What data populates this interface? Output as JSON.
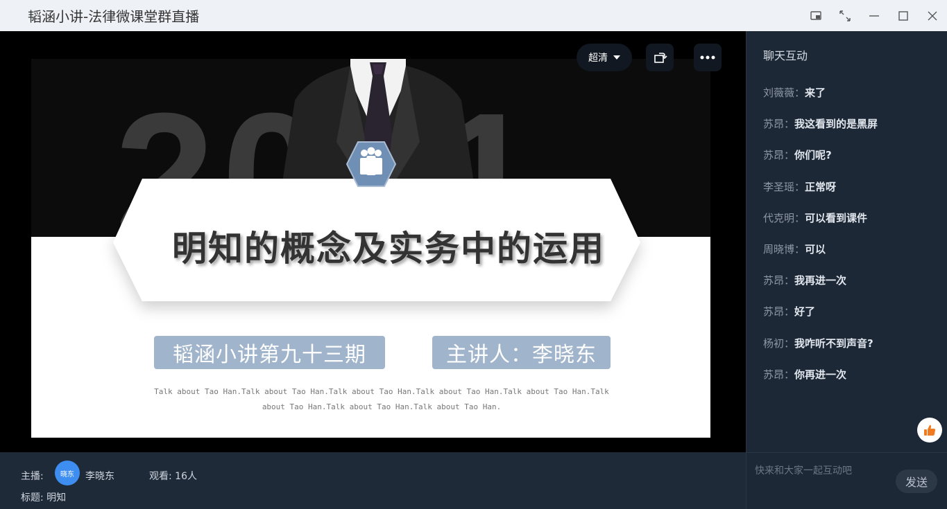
{
  "window": {
    "title": "韬涵小讲-法律微课堂群直播"
  },
  "video": {
    "quality_label": "超清"
  },
  "slide": {
    "year": "2021",
    "title": "明知的概念及实务中的运用",
    "episode": "韬涵小讲第九十三期",
    "speaker": "主讲人：李晓东",
    "tagline": "Talk about Tao Han.Talk about Tao Han.Talk about Tao Han.Talk about Tao Han.Talk about Tao Han.Talk about Tao Han.Talk about Tao Han.Talk about Tao Han."
  },
  "info": {
    "host_label": "主播:",
    "avatar_text": "晓东",
    "host_name": "李晓东",
    "viewers": "观看: 16人",
    "topic": "标题: 明知"
  },
  "chat": {
    "title": "聊天互动",
    "messages": [
      {
        "who": "刘薇薇：",
        "text": "来了"
      },
      {
        "who": "苏昂：",
        "text": "我这看到的是黑屏"
      },
      {
        "who": "苏昂：",
        "text": "你们呢?"
      },
      {
        "who": "李圣瑶：",
        "text": "正常呀"
      },
      {
        "who": "代克明：",
        "text": "可以看到课件"
      },
      {
        "who": "周晓博：",
        "text": "可以"
      },
      {
        "who": "苏昂：",
        "text": "我再进一次"
      },
      {
        "who": "苏昂：",
        "text": "好了"
      },
      {
        "who": "杨初：",
        "text": "我咋听不到声音?"
      },
      {
        "who": "苏昂：",
        "text": "你再进一次"
      }
    ],
    "input_placeholder": "快来和大家一起互动吧",
    "send_label": "发送"
  },
  "colors": {
    "accent": "#3d8ef0",
    "pill": "#a0b4cb",
    "like": "#f07a20"
  }
}
